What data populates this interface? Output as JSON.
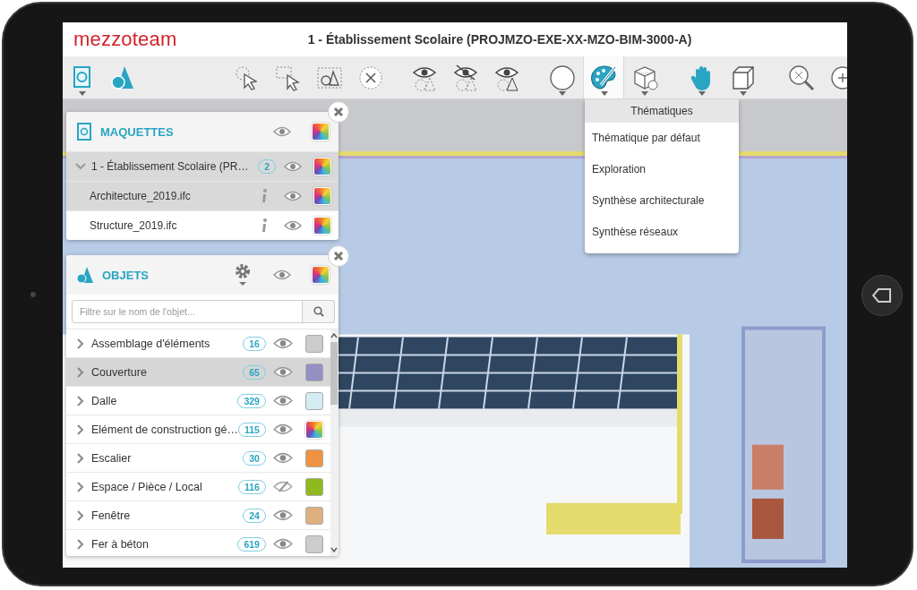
{
  "header": {
    "logo": "mezzoteam",
    "title": "1 - Établissement Scolaire (PROJMZO-EXE-XX-MZO-BIM-3000-A)"
  },
  "toolbar": {
    "groups": [
      [
        {
          "selected": false,
          "caret": true
        },
        {
          "selected": false,
          "caret": false
        }
      ],
      [
        {
          "selected": false,
          "caret": false
        },
        {
          "selected": false,
          "caret": false
        },
        {
          "selected": false,
          "caret": false
        },
        {
          "selected": false,
          "caret": false
        }
      ],
      [
        {
          "selected": false,
          "caret": false
        },
        {
          "selected": false,
          "caret": false
        },
        {
          "selected": false,
          "caret": false
        }
      ],
      [
        {
          "selected": false,
          "caret": true
        },
        {
          "selected": true,
          "caret": true
        },
        {
          "selected": false,
          "caret": true
        }
      ],
      [
        {
          "selected": false,
          "caret": true
        },
        {
          "selected": false,
          "caret": true
        }
      ],
      [
        {
          "selected": false,
          "caret": false
        },
        {
          "selected": false,
          "caret": false
        }
      ]
    ]
  },
  "theme_menu": {
    "title": "Thématiques",
    "items": [
      "Thématique par défaut",
      "Exploration",
      "Synthèse architecturale",
      "Synthèse réseaux"
    ]
  },
  "models_panel": {
    "title": "MAQUETTES",
    "project": {
      "name": "1 - Établissement Scolaire (PR…",
      "count": "2",
      "expanded": true,
      "selected": true
    },
    "files": [
      {
        "name": "Architecture_2019.ifc",
        "selected": true
      },
      {
        "name": "Structure_2019.ifc",
        "selected": false
      }
    ]
  },
  "objects_panel": {
    "title": "OBJETS",
    "filter": {
      "placeholder": "Filtre sur le nom de l'objet..."
    },
    "rows": [
      {
        "name": "Assemblage d'éléments",
        "count": "16",
        "visible": true,
        "selected": false,
        "kind": "solid",
        "color": "#cccccc"
      },
      {
        "name": "Couverture",
        "count": "65",
        "visible": true,
        "selected": true,
        "kind": "solid",
        "color": "#9490c4"
      },
      {
        "name": "Dalle",
        "count": "329",
        "visible": true,
        "selected": false,
        "kind": "solid",
        "color": "#d4ebf2"
      },
      {
        "name": "Elément de construction gé…",
        "count": "115",
        "visible": true,
        "selected": false,
        "kind": "multicolor"
      },
      {
        "name": "Escalier",
        "count": "30",
        "visible": true,
        "selected": false,
        "kind": "solid",
        "color": "#ef9244"
      },
      {
        "name": "Espace / Pièce / Local",
        "count": "116",
        "visible": false,
        "selected": false,
        "kind": "solid",
        "color": "#8fb91e"
      },
      {
        "name": "Fenêtre",
        "count": "24",
        "visible": true,
        "selected": false,
        "kind": "solid",
        "color": "#deb07e"
      },
      {
        "name": "Fer à béton",
        "count": "619",
        "visible": true,
        "selected": false,
        "kind": "solid",
        "color": "#cccccc"
      }
    ]
  }
}
